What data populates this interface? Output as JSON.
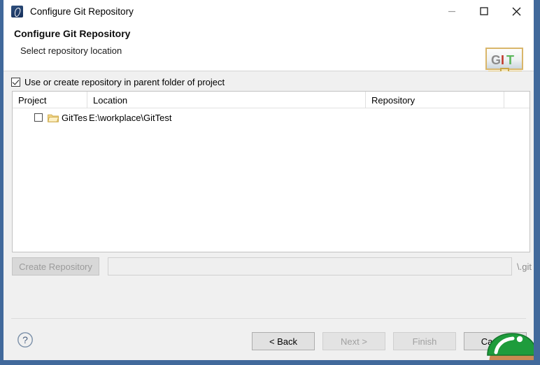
{
  "window": {
    "title": "Configure Git Repository",
    "app_icon": "eclipse-git-icon",
    "controls": {
      "minimize": "minimize-icon",
      "maximize": "maximize-icon",
      "close": "close-icon"
    }
  },
  "header": {
    "title": "Configure Git Repository",
    "subtitle": "Select repository location",
    "logo_text": "GIT",
    "logo_letters": [
      "G",
      "I",
      "T"
    ]
  },
  "options": {
    "use_parent_folder": {
      "label": "Use or create repository in parent folder of project",
      "checked": true
    }
  },
  "table": {
    "columns": [
      "Project",
      "Location",
      "Repository"
    ],
    "rows": [
      {
        "checked": false,
        "icon": "folder-icon",
        "project": "GitTest",
        "location": "E:\\workplace\\GitTest",
        "repository": ""
      }
    ]
  },
  "create_row": {
    "button_label": "Create Repository",
    "button_enabled": false,
    "path_value": "",
    "path_placeholder": "",
    "suffix_label": "\\.git"
  },
  "footer": {
    "help_label": "?",
    "buttons": [
      {
        "label": "< Back",
        "enabled": true
      },
      {
        "label": "Next >",
        "enabled": false
      },
      {
        "label": "Finish",
        "enabled": false
      },
      {
        "label": "Cancel",
        "enabled": true
      }
    ]
  },
  "colors": {
    "window_border": "#41699b",
    "dialog_bg": "#f0f0f0",
    "content_bg": "#ffffff",
    "accent_green": "#1e9c3c",
    "git_red": "#c0392b",
    "git_green": "#5cb85c"
  }
}
